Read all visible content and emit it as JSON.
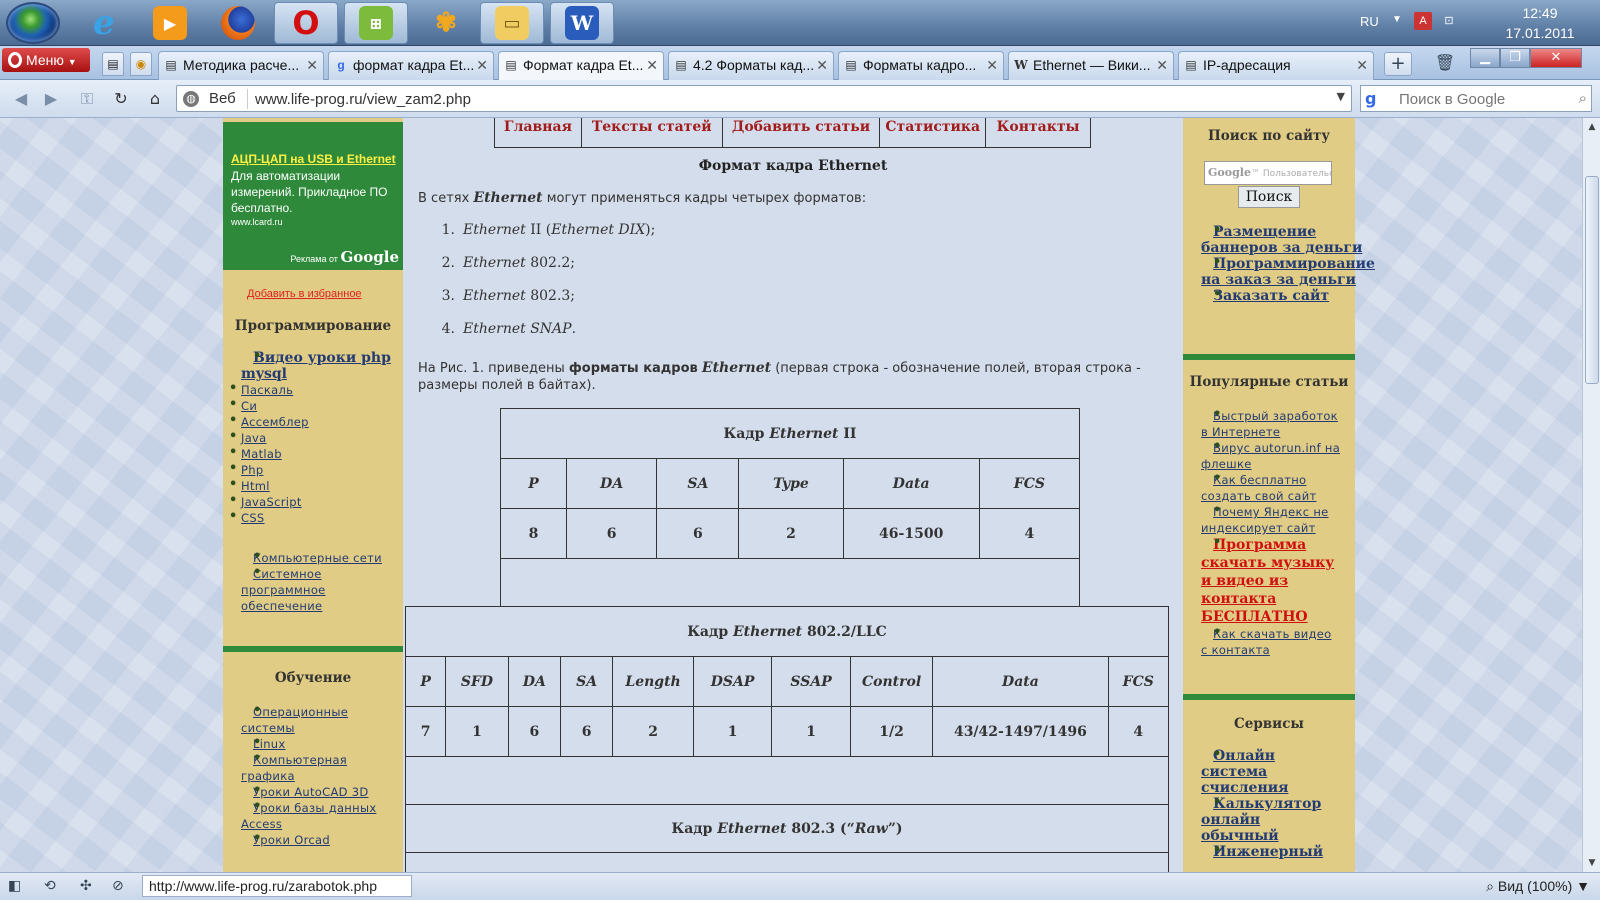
{
  "taskbar": {
    "apps": [
      "windows-start",
      "internet-explorer",
      "media-player",
      "firefox",
      "opera",
      "network-tool",
      "butterfly-app",
      "file-explorer",
      "word"
    ],
    "language": "RU",
    "time": "12:49",
    "date": "17.01.2011",
    "tray_icons": [
      "keyboard-layout-icon",
      "network-icon"
    ]
  },
  "browser": {
    "menu_label": "Меню",
    "tabs": [
      {
        "title": "Методика расче...",
        "active": false
      },
      {
        "title": "формат кадра Et...",
        "active": false
      },
      {
        "title": "Формат кадра Et...",
        "active": true
      },
      {
        "title": "4.2 Форматы кад...",
        "active": false
      },
      {
        "title": "Форматы кадро...",
        "active": false
      },
      {
        "title": "Ethernet — Вики...",
        "active": false
      },
      {
        "title": "IP-адресация",
        "active": false
      }
    ],
    "address_prefix": "Веб",
    "url": "www.life-prog.ru/view_zam2.php",
    "search_placeholder": "Поиск в Google",
    "status_url": "http://www.life-prog.ru/zarabotok.php",
    "zoom": "Вид (100%)"
  },
  "left": {
    "ad": {
      "title": "АЦП-ЦАП на USB и Ethernet",
      "text": "Для автоматизации измерений. Прикладное ПО бесплатно.",
      "url": "www.lcard.ru",
      "by": "Реклама от",
      "google": "Google"
    },
    "favorite": "Добавить в избранное",
    "programming_title": "Программирование",
    "programming_big": "Видео уроки php mysql",
    "programming": [
      "Паскаль",
      "Си",
      "Ассемблер",
      "Java",
      "Matlab",
      "Php",
      "Html",
      "JavaScript",
      "CSS"
    ],
    "programming2": [
      "Компьютерные сети",
      "Системное программное обеспечение"
    ],
    "learning_title": "Обучение",
    "learning": [
      "Операционные системы",
      "Linux",
      "Компьютерная графика",
      "Уроки AutoCAD 3D",
      "Уроки базы данных Access",
      "Уроки Orcad"
    ]
  },
  "main": {
    "nav": [
      "Главная",
      "Тексты статей",
      "Добавить статьи",
      "Статистика",
      "Контакты"
    ],
    "title": "Формат кадра Ethernet",
    "intro_a": "В сетях ",
    "intro_b": "Ethernet",
    "intro_c": " могут применяться кадры четырех форматов:",
    "formats": [
      {
        "n": "1.",
        "a": "Ethernet",
        "b": " II (",
        "c": "Ethernet DIX",
        "d": ");"
      },
      {
        "n": "2.",
        "a": "Ethernet",
        "b": " 802.2;",
        "c": "",
        "d": ""
      },
      {
        "n": "3.",
        "a": "Ethernet",
        "b": " 802.3;",
        "c": "",
        "d": ""
      },
      {
        "n": "4.",
        "a": "Ethernet SNAP",
        "b": ".",
        "c": "",
        "d": ""
      }
    ],
    "fig_a": "На Рис. 1. приведены ",
    "fig_b": "форматы кадров",
    "fig_c": "Ethernet",
    "fig_d": " (первая строка - обозначение полей, вторая строка - размеры полей в байтах).",
    "tables": [
      {
        "cap_a": "Кадр ",
        "cap_b": "Ethernet",
        "cap_c": " II",
        "headers": [
          "P",
          "DA",
          "SA",
          "Type",
          "Data",
          "FCS"
        ],
        "values": [
          "8",
          "6",
          "6",
          "2",
          "46-1500",
          "4"
        ]
      },
      {
        "cap_a": "Кадр ",
        "cap_b": "Ethernet",
        "cap_c": " 802.2/LLC",
        "headers": [
          "P",
          "SFD",
          "DA",
          "SA",
          "Length",
          "DSAP",
          "SSAP",
          "Control",
          "Data",
          "FCS"
        ],
        "values": [
          "7",
          "1",
          "6",
          "6",
          "2",
          "1",
          "1",
          "1/2",
          "43/42-1497/1496",
          "4"
        ]
      },
      {
        "cap_a": "Кадр ",
        "cap_b": "Ethernet",
        "cap_c": " 802.3 (“",
        "cap_d": "Raw",
        "cap_e": "”)"
      }
    ]
  },
  "right": {
    "search_title": "Поиск по сайту",
    "search_placeholder": "Пользовательс",
    "search_button": "Поиск",
    "links1": [
      "Размещение баннеров за деньги",
      "Программирование на заказ за деньги",
      "Заказать сайт"
    ],
    "popular_title": "Популярные статьи",
    "popular": [
      "Быстрый заработок в Интернете",
      "Вирус autorun.inf на флешке",
      "Как бесплатно создать свой сайт",
      "Почему Яндекс не индексирует сайт"
    ],
    "popular_red": "Программа скачать музыку и видео из контакта БЕСПЛАТНО",
    "popular2": [
      "Как скачать видео с контакта"
    ],
    "services_title": "Сервисы",
    "services": [
      "Онлайн система счисления",
      "Калькулятор онлайн обычный",
      "Инженерный"
    ]
  }
}
